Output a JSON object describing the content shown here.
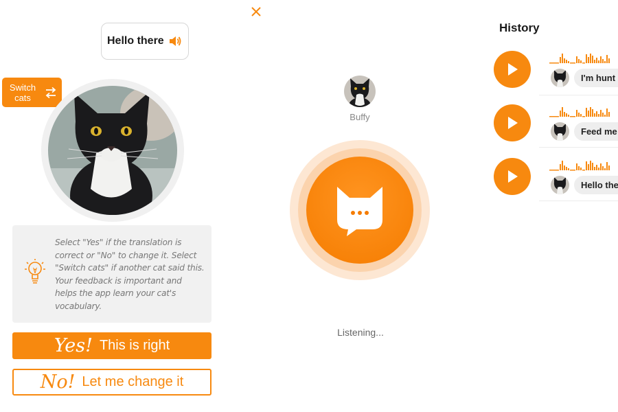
{
  "left_panel": {
    "bubble_text": "Hello there",
    "switch_label": "Switch\ncats",
    "tip_text": "Select \"Yes\" if the translation is correct or \"No\" to change it. Select \"Switch cats\" if another cat said this. Your feedback is important and helps the app learn your cat's vocabulary.",
    "yes_big": "Yes!",
    "yes_small": "This is right",
    "no_big": "No!",
    "no_small": "Let me change it"
  },
  "middle_panel": {
    "cat_name": "Buffy",
    "status": "Listening..."
  },
  "history": {
    "title": "History",
    "items": [
      {
        "message": "I'm hunt"
      },
      {
        "message": "Feed me"
      },
      {
        "message": "Hello the"
      }
    ]
  },
  "colors": {
    "accent": "#f7890f",
    "accent_dark": "#f57c00",
    "tip_bg": "#f1f1f1",
    "pill_bg": "#eeeeee"
  },
  "icons": {
    "close": "close-icon",
    "speaker": "speaker-icon",
    "switch": "swap-arrows-icon",
    "bulb": "lightbulb-icon",
    "cat": "cat-head-icon",
    "play": "play-icon"
  }
}
